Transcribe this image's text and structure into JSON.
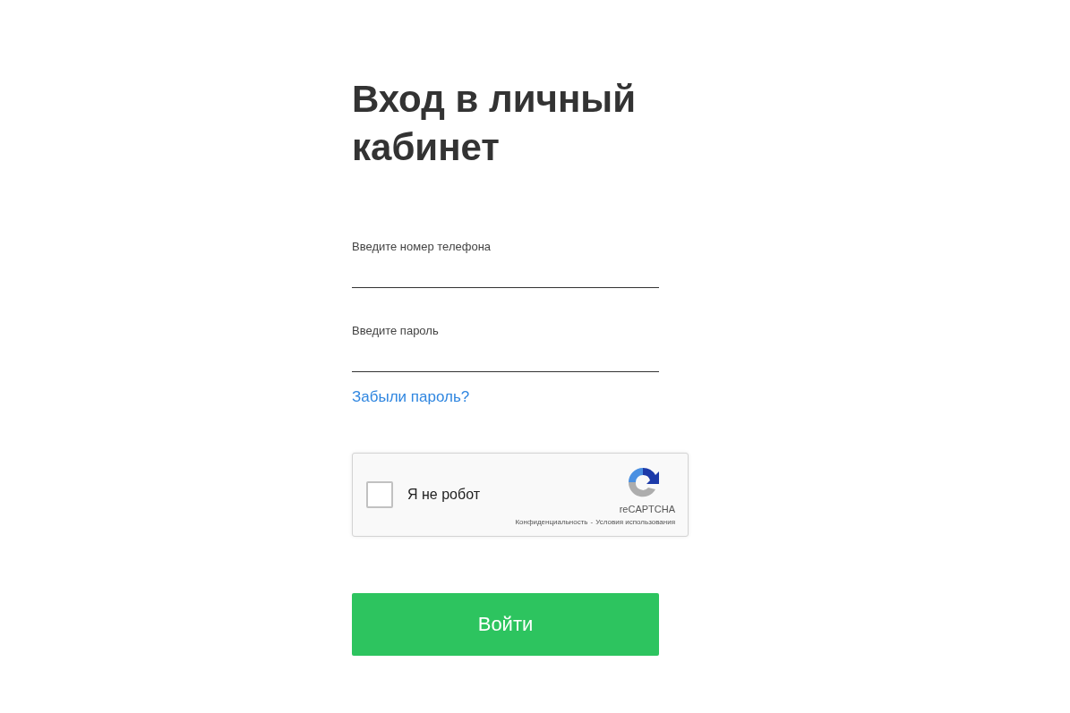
{
  "title": "Вход в личный кабинет",
  "fields": [
    {
      "label": "Введите номер телефона"
    },
    {
      "label": "Введите пароль"
    }
  ],
  "forgot_link": "Забыли пароль?",
  "captcha": {
    "label": "Я не робот",
    "checked": false,
    "brand": "reCAPTCHA",
    "links": [
      "Конфиденциальность",
      "Условия использования"
    ],
    "separator": "-"
  },
  "submit": "Войти"
}
